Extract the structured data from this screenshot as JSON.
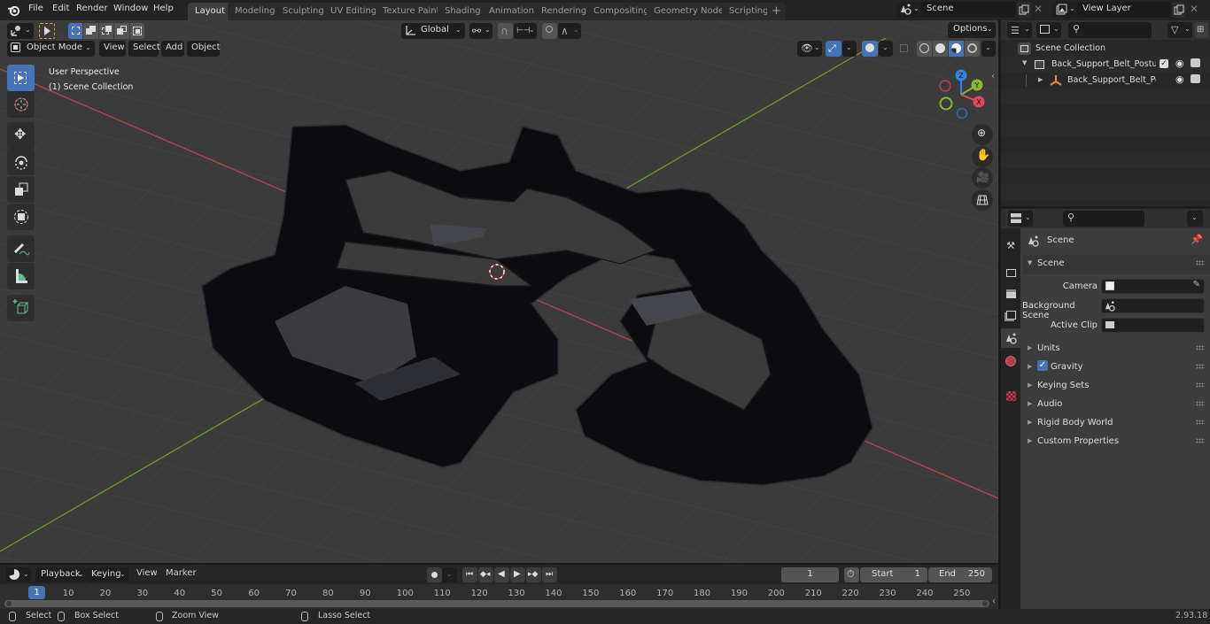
{
  "app": {
    "name": "Blender",
    "version": "2.93.18"
  },
  "menubar": {
    "items": [
      "File",
      "Edit",
      "Render",
      "Window",
      "Help"
    ]
  },
  "workspaces": {
    "tabs": [
      "Layout",
      "Modeling",
      "Sculpting",
      "UV Editing",
      "Texture Paint",
      "Shading",
      "Animation",
      "Rendering",
      "Compositing",
      "Geometry Nodes",
      "Scripting"
    ],
    "active": "Layout",
    "add_label": "+"
  },
  "scene_selector": {
    "value": "Scene",
    "icon": "scene-icon"
  },
  "view_layer_selector": {
    "value": "View Layer",
    "icon": "render-layer-icon"
  },
  "viewport": {
    "mode": "Object Mode",
    "menus": [
      "View",
      "Select",
      "Add",
      "Object"
    ],
    "transform_orientation": "Global",
    "options_label": "Options",
    "overlay_text": {
      "line1": "User Perspective",
      "line2": "(1) Scene Collection"
    },
    "tools": [
      "select-box",
      "cursor",
      "move",
      "rotate",
      "scale",
      "transform",
      "annotate",
      "measure",
      "add-cube"
    ],
    "active_tool": "select-box",
    "gizmo_axes": [
      "X",
      "Y",
      "Z"
    ],
    "nav_buttons": [
      "zoom",
      "pan",
      "camera",
      "ortho-grid"
    ],
    "colors": {
      "x_axis": "#e0485a",
      "y_axis": "#8ab931",
      "z_axis": "#2f85e0",
      "grid_bg": "#3b3b3b",
      "selected_blue": "#4772b3"
    }
  },
  "outliner": {
    "root": "Scene Collection",
    "items": [
      {
        "name": "Back_Support_Belt_Posture_C",
        "type": "collection",
        "checked": true,
        "visible": true
      },
      {
        "name": "Back_Support_Belt_Postu",
        "type": "object",
        "visible": true
      }
    ],
    "search_placeholder": ""
  },
  "properties": {
    "context": "Scene",
    "section": "Scene",
    "fields": [
      {
        "label": "Camera",
        "value": ""
      },
      {
        "label": "Background Scene",
        "value": ""
      },
      {
        "label": "Active Clip",
        "value": ""
      }
    ],
    "panels": [
      {
        "label": "Units",
        "checkbox": false
      },
      {
        "label": "Gravity",
        "checkbox": true
      },
      {
        "label": "Keying Sets",
        "checkbox": false
      },
      {
        "label": "Audio",
        "checkbox": false
      },
      {
        "label": "Rigid Body World",
        "checkbox": false
      },
      {
        "label": "Custom Properties",
        "checkbox": false
      }
    ]
  },
  "timeline": {
    "menus": [
      "Playback",
      "Keying",
      "View",
      "Marker"
    ],
    "current_frame": "1",
    "start_label": "Start",
    "start": "1",
    "end_label": "End",
    "end": "250",
    "ticks": [
      "10",
      "20",
      "30",
      "40",
      "50",
      "60",
      "70",
      "80",
      "90",
      "100",
      "110",
      "120",
      "130",
      "140",
      "150",
      "160",
      "170",
      "180",
      "190",
      "200",
      "210",
      "220",
      "230",
      "240",
      "250"
    ],
    "playhead": "1"
  },
  "statusbar": {
    "items": [
      "Select",
      "Box Select",
      "Zoom View",
      "Lasso Select"
    ],
    "version": "2.93.18"
  }
}
